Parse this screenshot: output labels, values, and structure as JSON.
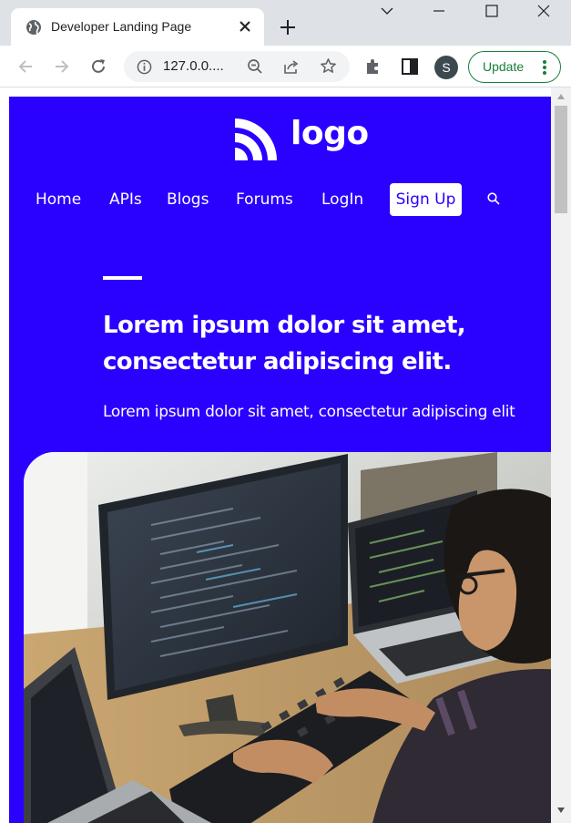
{
  "browser": {
    "tab_title": "Developer Landing Page",
    "url": "127.0.0....",
    "profile_initial": "S",
    "update_label": "Update"
  },
  "page": {
    "logo_text": "logo",
    "nav": [
      "Home",
      "APIs",
      "Blogs",
      "Forums",
      "LogIn"
    ],
    "signup_label": "Sign Up",
    "hero_title": "Lorem ipsum dolor sit amet, consectetur adipiscing elit.",
    "hero_subtitle": "Lorem ipsum dolor sit amet, consectetur adipiscing elit",
    "colors": {
      "brand_blue": "#2a00ff",
      "update_green": "#188038"
    }
  },
  "icons": {
    "tab": "globe-icon",
    "close": "close-icon",
    "new_tab": "plus-icon",
    "back": "back-arrow-icon",
    "forward": "forward-arrow-icon",
    "reload": "reload-icon",
    "info": "info-icon",
    "zoom": "zoom-out-icon",
    "share": "share-icon",
    "bookmark": "star-icon",
    "extensions": "puzzle-icon",
    "side_panel": "side-panel-icon",
    "search": "search-icon"
  }
}
